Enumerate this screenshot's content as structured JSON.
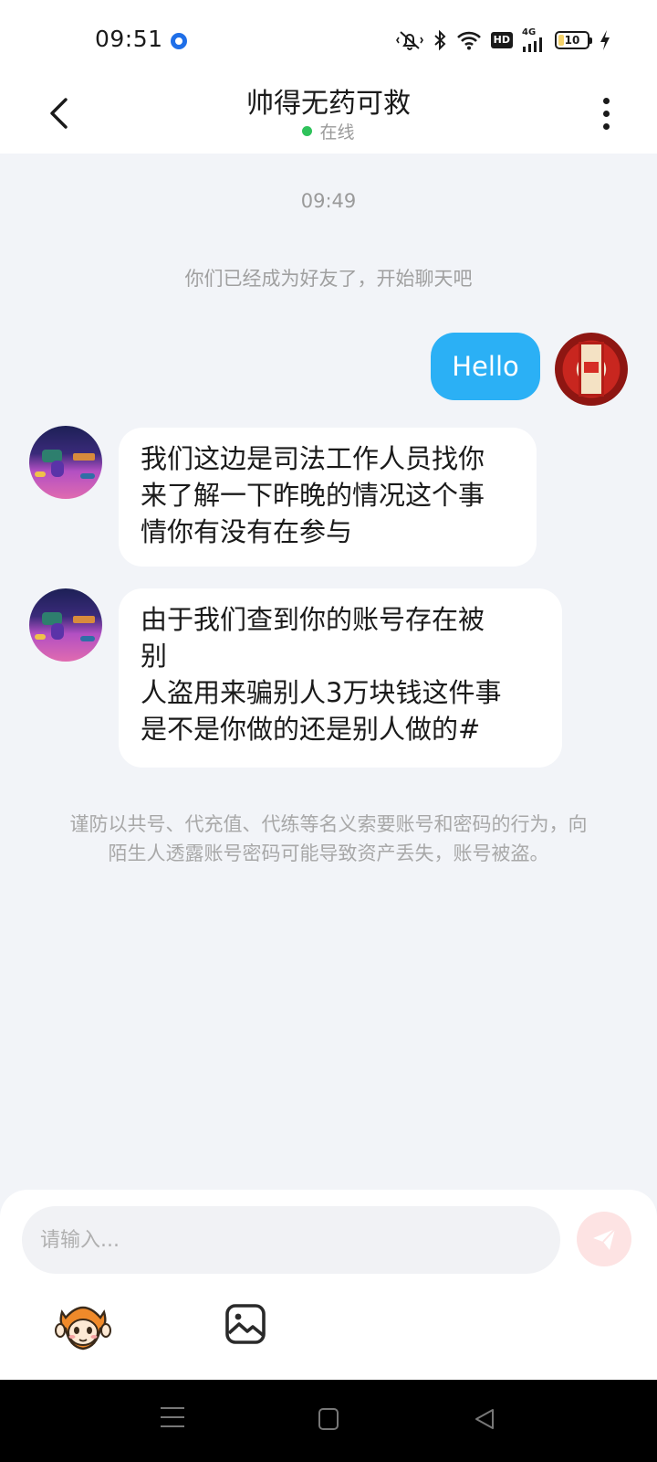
{
  "status_bar": {
    "time": "09:51",
    "network_label": "4G",
    "hd_label": "HD",
    "battery_level": "10"
  },
  "header": {
    "title": "帅得无药可救",
    "status": "在线",
    "status_color": "#2fc25b"
  },
  "chat": {
    "timestamp": "09:49",
    "system_note": "你们已经成为好友了，开始聊天吧",
    "messages": [
      {
        "sender": "self",
        "text": "Hello"
      },
      {
        "sender": "other",
        "text": "我们这边是司法工作人员找你\n来了解一下昨晚的情况这个事\n情你有没有在参与"
      },
      {
        "sender": "other",
        "text": "由于我们查到你的账号存在被\n别\n人盗用来骗别人3万块钱这件事\n是不是你做的还是别人做的#"
      }
    ],
    "warning": "谨防以共号、代充值、代练等名义索要账号和密码的行为，向陌生人透露账号密码可能导致资产丢失，账号被盗。"
  },
  "composer": {
    "placeholder": "请输入...",
    "send_icon": "send-plane-icon",
    "emoji_icon": "monkey-emoji-icon",
    "image_icon": "image-icon"
  },
  "colors": {
    "self_bubble": "#2bb0f5",
    "background": "#f2f4f8",
    "send_button": "#fde3e3"
  }
}
